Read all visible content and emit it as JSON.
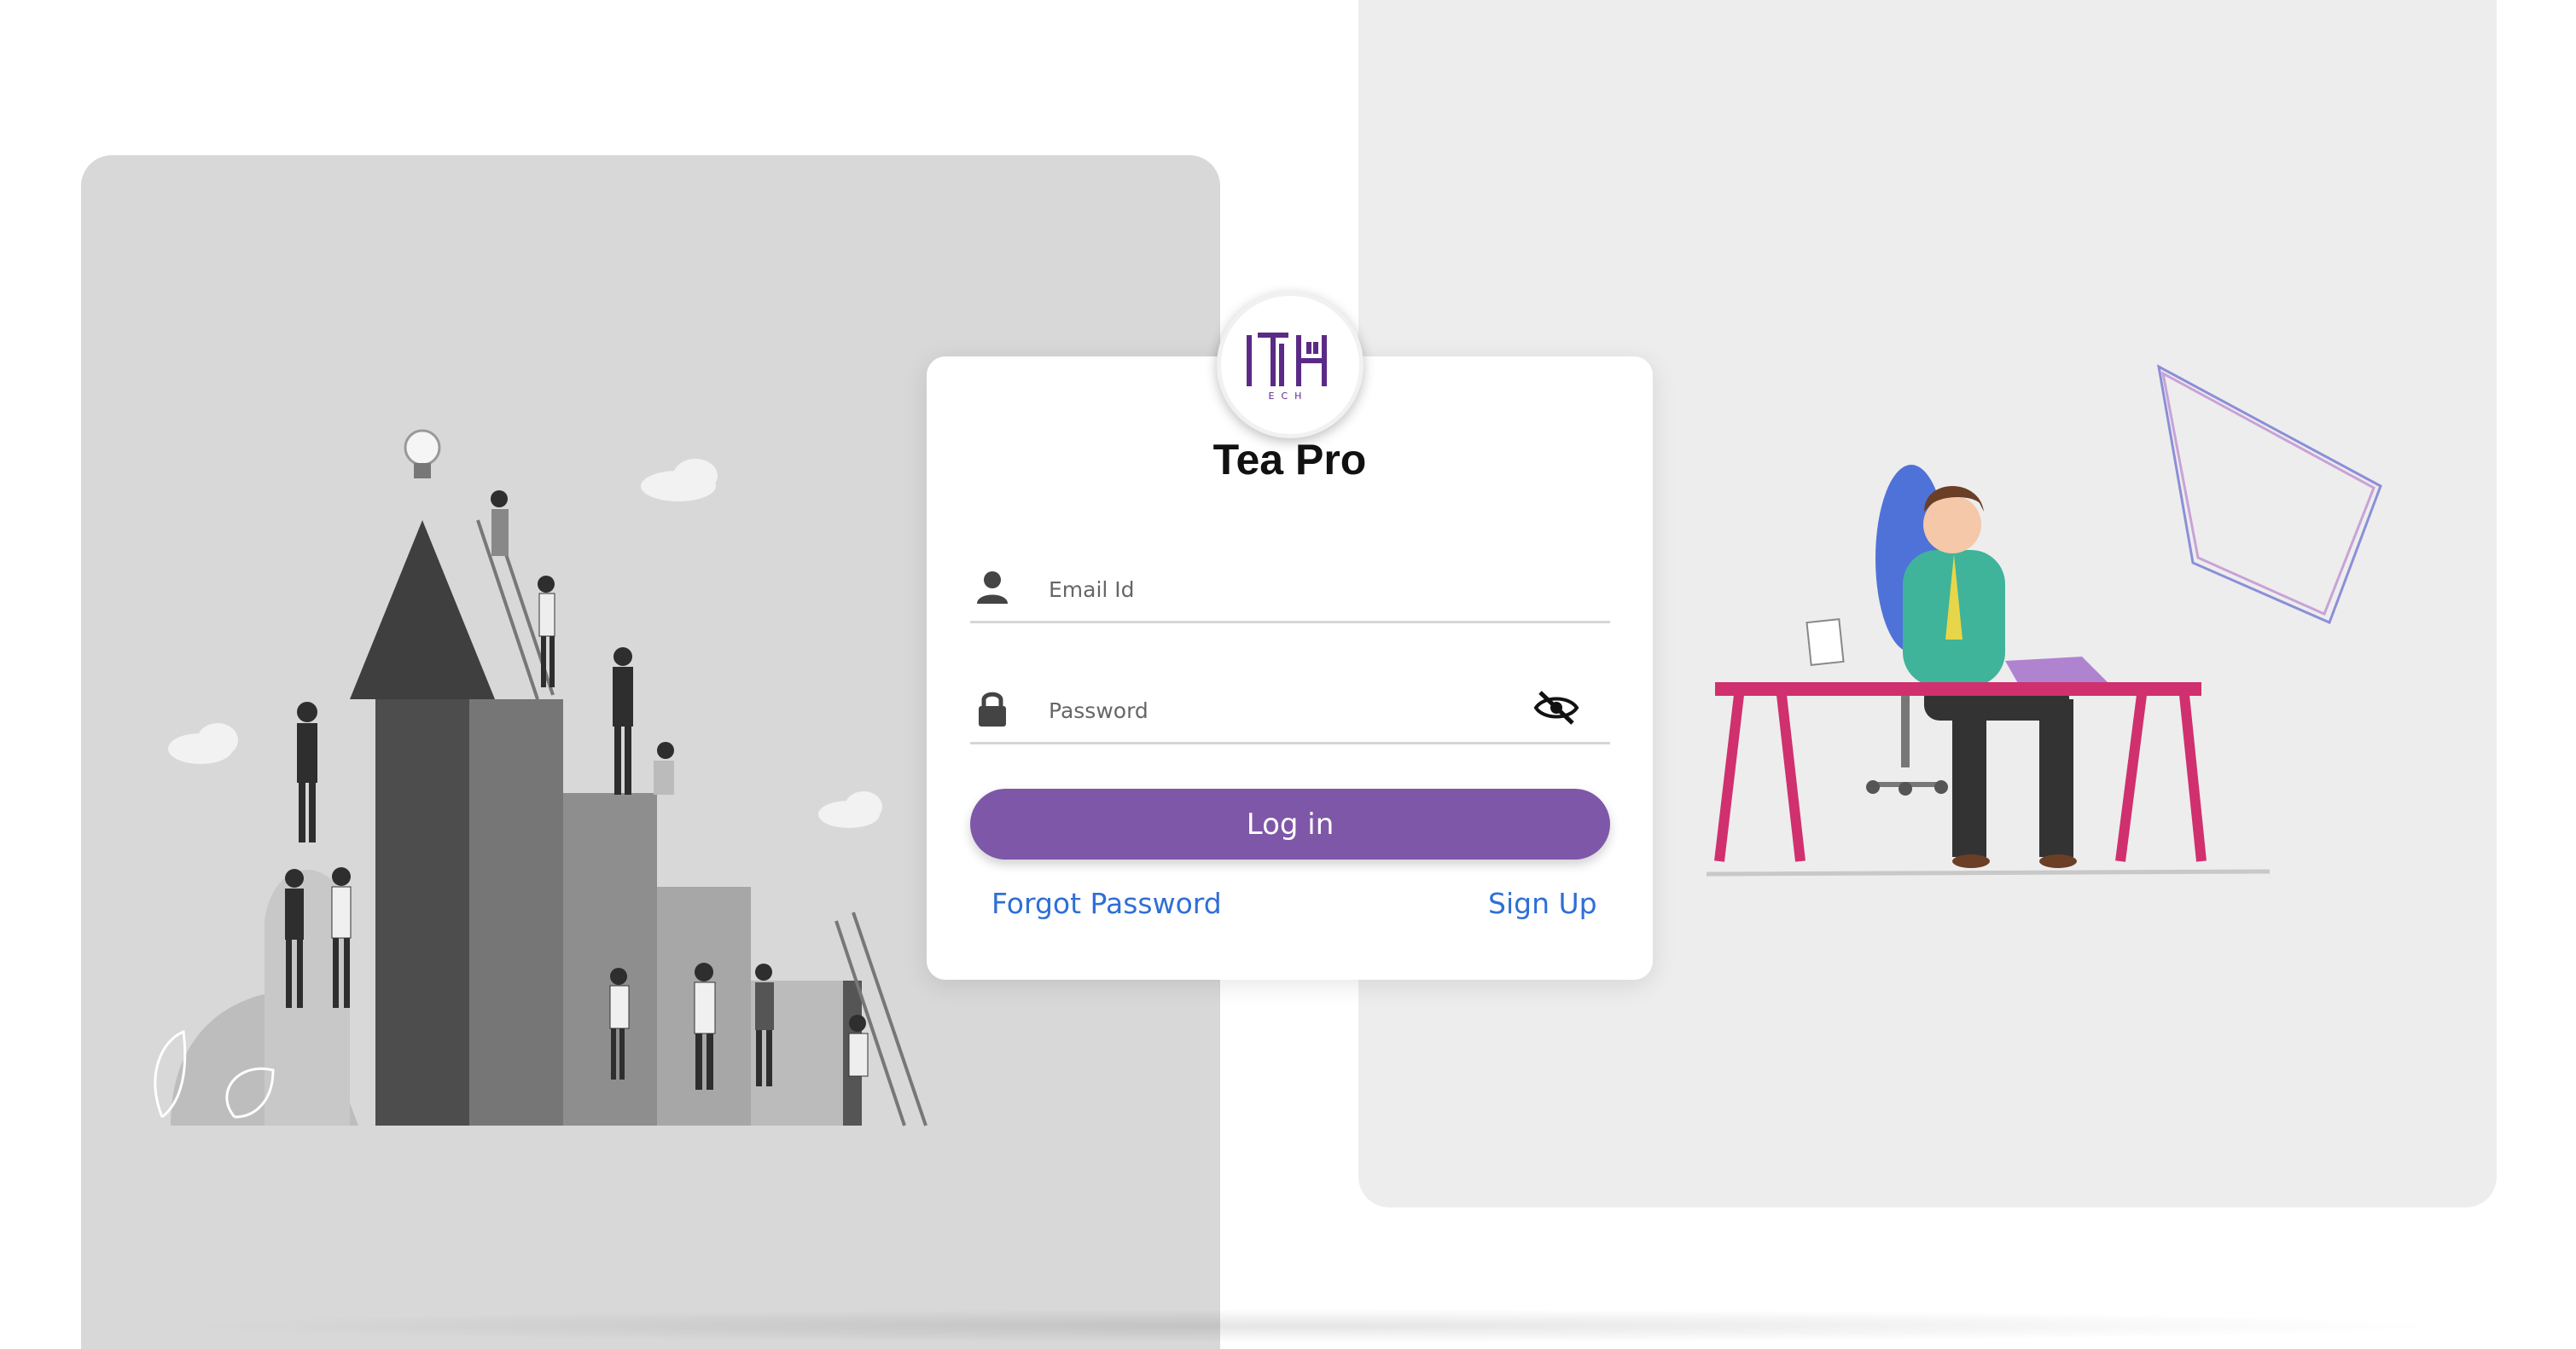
{
  "brand": {
    "logo_text": "ITH",
    "logo_subtext": "ECH",
    "logo_color": "#5b2a86",
    "app_name": "Tea Pro"
  },
  "form": {
    "email": {
      "placeholder": "Email Id",
      "value": "",
      "icon": "user-icon"
    },
    "password": {
      "placeholder": "Password",
      "value": "",
      "icon": "lock-icon",
      "toggle_icon": "eye-off-icon"
    },
    "login_label": "Log in",
    "forgot_label": "Forgot Password",
    "signup_label": "Sign Up"
  },
  "colors": {
    "primary": "#7e57a8",
    "link": "#2f6fd6",
    "panel_left": "#d8d8d8",
    "panel_right": "#ededed",
    "desk": "#d0306e"
  },
  "illustrations": {
    "left": "growth-stairs-illustration",
    "right": "man-at-desk-illustration"
  }
}
